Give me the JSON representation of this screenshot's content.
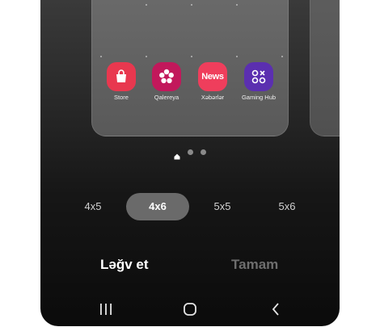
{
  "apps": [
    {
      "label": "Store",
      "icon": "store-bag-icon",
      "color": "#e8384f"
    },
    {
      "label": "Qalereya",
      "icon": "gallery-flower-icon",
      "color": "#c2185b"
    },
    {
      "label": "Xəbərlər",
      "icon": "news-icon",
      "icon_text": "News",
      "color": "#ef3e5c"
    },
    {
      "label": "Gaming Hub",
      "icon": "gaming-hub-icon",
      "color": "#5b2fb0"
    }
  ],
  "page_indicator": {
    "count": 3,
    "current": "home"
  },
  "grid_options": [
    {
      "label": "4x5",
      "selected": false
    },
    {
      "label": "4x6",
      "selected": true
    },
    {
      "label": "5x5",
      "selected": false
    },
    {
      "label": "5x6",
      "selected": false
    }
  ],
  "actions": {
    "cancel_label": "Ləğv et",
    "done_label": "Tamam"
  },
  "nav": {
    "recents_icon": "recents-icon",
    "home_icon": "home-icon",
    "back_icon": "back-icon"
  },
  "colors": {
    "selected_pill": "#6a6a6a",
    "done_disabled": "#6e6e6e",
    "cancel": "#ffffff"
  }
}
